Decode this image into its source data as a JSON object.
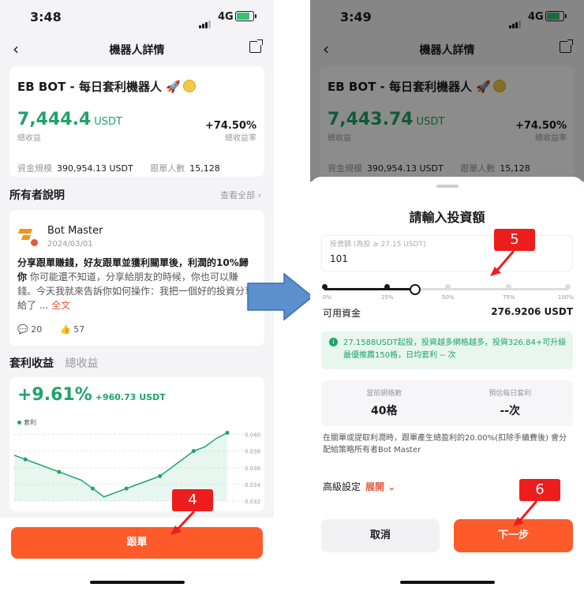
{
  "left": {
    "time": "3:48",
    "network": "4G",
    "nav_title": "機器人詳情",
    "bot_title": "EB BOT - 每日套利機器人 🚀",
    "total_profit": "7,444.4",
    "unit": "USDT",
    "total_profit_label": "總收益",
    "total_rate": "+74.50%",
    "total_rate_label": "總收益率",
    "fund_size_label": "資金規模",
    "fund_size": "390,954.13 USDT",
    "followers_label": "跟單人數",
    "followers": "15,128",
    "owner_section": "所有者說明",
    "view_all": "查看全部",
    "owner_name": "Bot Master",
    "owner_date": "2024/03/01",
    "desc_bold": "分享跟單賺錢，好友跟單並獲利關單後，利潤的10%歸你",
    "desc_text": "你可能還不知道，分享給朋友的時候，你也可以賺錢。今天我就來告訴你如何操作：我把一個好的投資分享給了 ...",
    "desc_link": "全文",
    "comments": "20",
    "likes": "57",
    "tab_active": "套利收益",
    "tab_inactive": "總收益",
    "arb_pct": "+9.61%",
    "arb_amount": "+960.73 USDT",
    "legend": "套利",
    "follow_button": "跟單",
    "marker": "4"
  },
  "right": {
    "time": "3:49",
    "network": "4G",
    "nav_title": "機器人詳情",
    "bot_title": "EB BOT - 每日套利機器人 🚀",
    "total_profit": "7,443.74",
    "unit": "USDT",
    "total_profit_label": "總收益",
    "total_rate": "+74.50%",
    "total_rate_label": "總收益率",
    "fund_size_label": "資金規模",
    "fund_size": "390,954.13 USDT",
    "followers_label": "跟單人數",
    "followers": "15,128",
    "sheet_title": "請輸入投資額",
    "input_placeholder": "投資額 (為投 ≥ 27.15 USDT)",
    "input_value": "101",
    "slider_labels": [
      "0%",
      "25%",
      "50%",
      "75%",
      "100%"
    ],
    "slider_position": 0.3,
    "available_label": "可用資金",
    "available_value": "276.9206 USDT",
    "notice": "27.1588USDT起投，投資越多網格越多，投資326.84+可升級最優推薦150格，日均套利 -- 次",
    "grid_count_label": "當前網格數",
    "grid_count": "40格",
    "daily_arb_label": "預估每日套利",
    "daily_arb": "--次",
    "note": "在關單或提取利潤時，跟單產生總盈利的20.00%(扣除手續費後) 會分配給策略所有者Bot Master",
    "advanced_label": "高級設定",
    "expand": "展開",
    "cancel_button": "取消",
    "next_button": "下一步",
    "marker5": "5",
    "marker6": "6"
  },
  "chart_data": {
    "type": "line",
    "title": "",
    "series": [
      {
        "name": "套利",
        "values": [
          0.0375,
          0.037,
          0.0365,
          0.036,
          0.0355,
          0.035,
          0.0345,
          0.0335,
          0.0325,
          0.033,
          0.0335,
          0.034,
          0.0345,
          0.035,
          0.036,
          0.037,
          0.038,
          0.0385,
          0.0395,
          0.0402
        ]
      }
    ],
    "y_ticks": [
      "0.040",
      "0.038",
      "0.036",
      "0.034",
      "0.032"
    ],
    "ylim": [
      0.032,
      0.041
    ]
  }
}
